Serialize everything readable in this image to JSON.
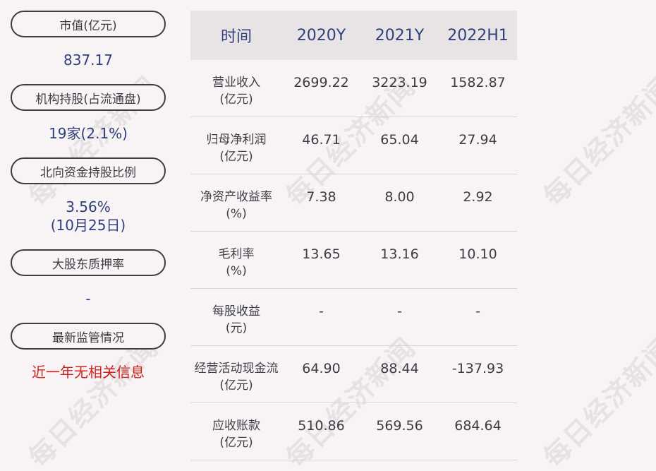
{
  "left": {
    "items": [
      {
        "label": "市值(亿元)",
        "value": "837.17"
      },
      {
        "label": "机构持股(占流通盘)",
        "value": "19家(2.1%)"
      },
      {
        "label": "北向资金持股比例",
        "value_line1": "3.56%",
        "value_line2": "(10月25日)"
      },
      {
        "label": "大股东质押率",
        "value": "-"
      },
      {
        "label": "最新监管情况",
        "value": "近一年无相关信息"
      }
    ]
  },
  "table": {
    "headers": [
      "时间",
      "2020Y",
      "2021Y",
      "2022H1"
    ],
    "rows": [
      {
        "label_line1": "营业收入",
        "label_line2": "(亿元)",
        "values": [
          "2699.22",
          "3223.19",
          "1582.87"
        ]
      },
      {
        "label_line1": "归母净利润",
        "label_line2": "(亿元)",
        "values": [
          "46.71",
          "65.04",
          "27.94"
        ]
      },
      {
        "label_line1": "净资产收益率",
        "label_line2": "(%)",
        "values": [
          "7.38",
          "8.00",
          "2.92"
        ]
      },
      {
        "label_line1": "毛利率",
        "label_line2": "(%)",
        "values": [
          "13.65",
          "13.16",
          "10.10"
        ]
      },
      {
        "label_line1": "每股收益",
        "label_line2": "(元)",
        "values": [
          "-",
          "-",
          "-"
        ]
      },
      {
        "label_line1": "经营活动现金流",
        "label_line2": "(亿元)",
        "values": [
          "64.90",
          "88.44",
          "-137.93"
        ]
      },
      {
        "label_line1": "应收账款",
        "label_line2": "(亿元)",
        "values": [
          "510.86",
          "569.56",
          "684.64"
        ]
      }
    ]
  },
  "watermark": "每日经济新闻",
  "colors": {
    "accent": "#2f3f7a",
    "red": "#d0201c",
    "text": "#3c3c44",
    "bg": "#f8f4f5"
  }
}
